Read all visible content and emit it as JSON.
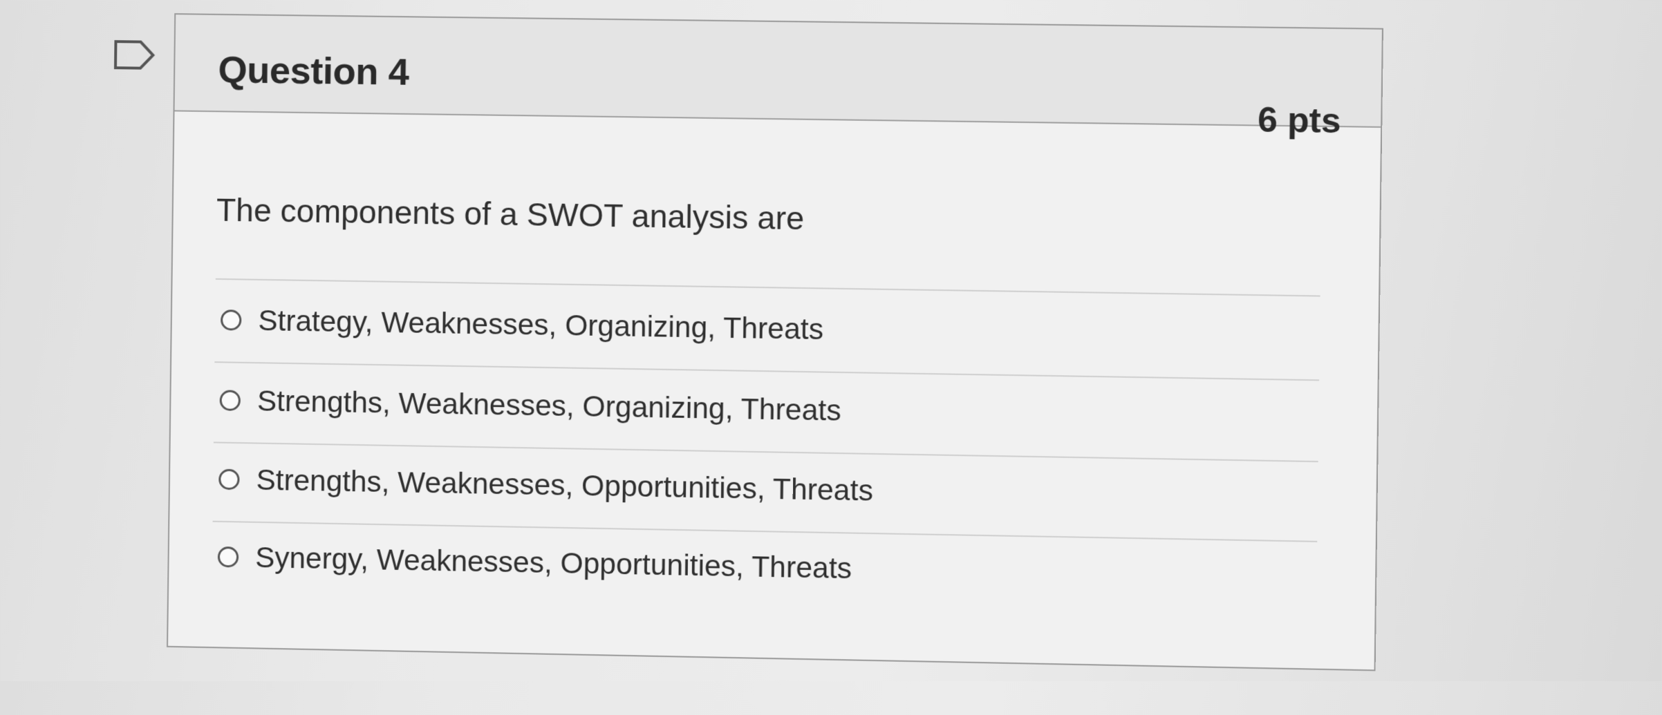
{
  "question": {
    "title": "Question 4",
    "points": "6 pts",
    "text": "The components of a SWOT analysis are",
    "flag_icon": "flag-question-icon",
    "options": [
      {
        "label": "Strategy, Weaknesses, Organizing, Threats",
        "selected": false
      },
      {
        "label": "Strengths, Weaknesses, Organizing, Threats",
        "selected": false
      },
      {
        "label": "Strengths, Weaknesses, Opportunities, Threats",
        "selected": false
      },
      {
        "label": "Synergy, Weaknesses, Opportunities, Threats",
        "selected": false
      }
    ]
  }
}
